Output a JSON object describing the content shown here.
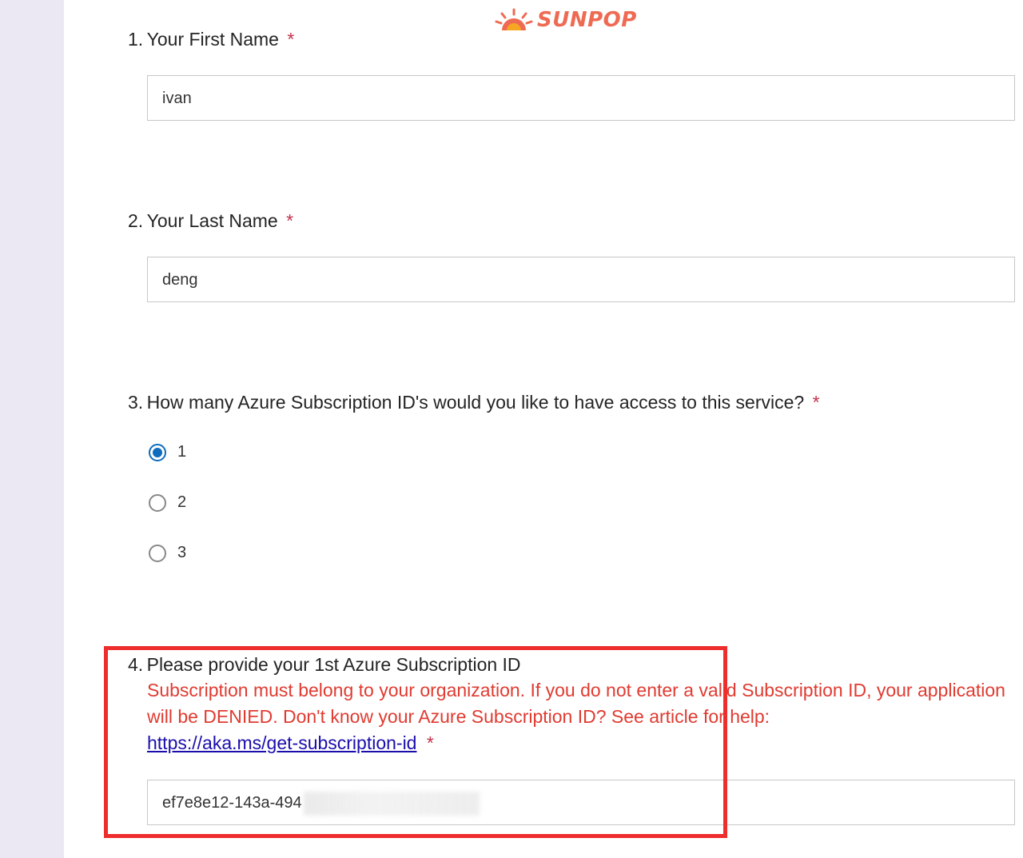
{
  "logo": {
    "text": "SUNPOP"
  },
  "questions": [
    {
      "number": "1.",
      "title": "Your First Name",
      "required_mark": "*",
      "value": "ivan"
    },
    {
      "number": "2.",
      "title": "Your Last Name",
      "required_mark": "*",
      "value": "deng"
    },
    {
      "number": "3.",
      "title": "How many Azure Subscription ID's would you like to have access to this service?",
      "required_mark": "*",
      "options": [
        "1",
        "2",
        "3"
      ],
      "selected": "1"
    },
    {
      "number": "4.",
      "title": "Please provide your 1st Azure Subscription ID",
      "description": "Subscription must belong to your organization. If you do not enter a valid Subscription ID, your application will be DENIED. Don't know your Azure Subscription ID? See article for help:",
      "link_text": "https://aka.ms/get-subscription-id",
      "required_mark": "*",
      "value_visible": "ef7e8e12-143a-494"
    }
  ],
  "colors": {
    "accent": "#0f6cbd",
    "required": "#c4314b",
    "warning_text": "#e03b31",
    "highlight": "#ee2d2d",
    "link": "#1a0dab",
    "sidebar": "#ebe8f4",
    "logo": "#ee6a52"
  }
}
